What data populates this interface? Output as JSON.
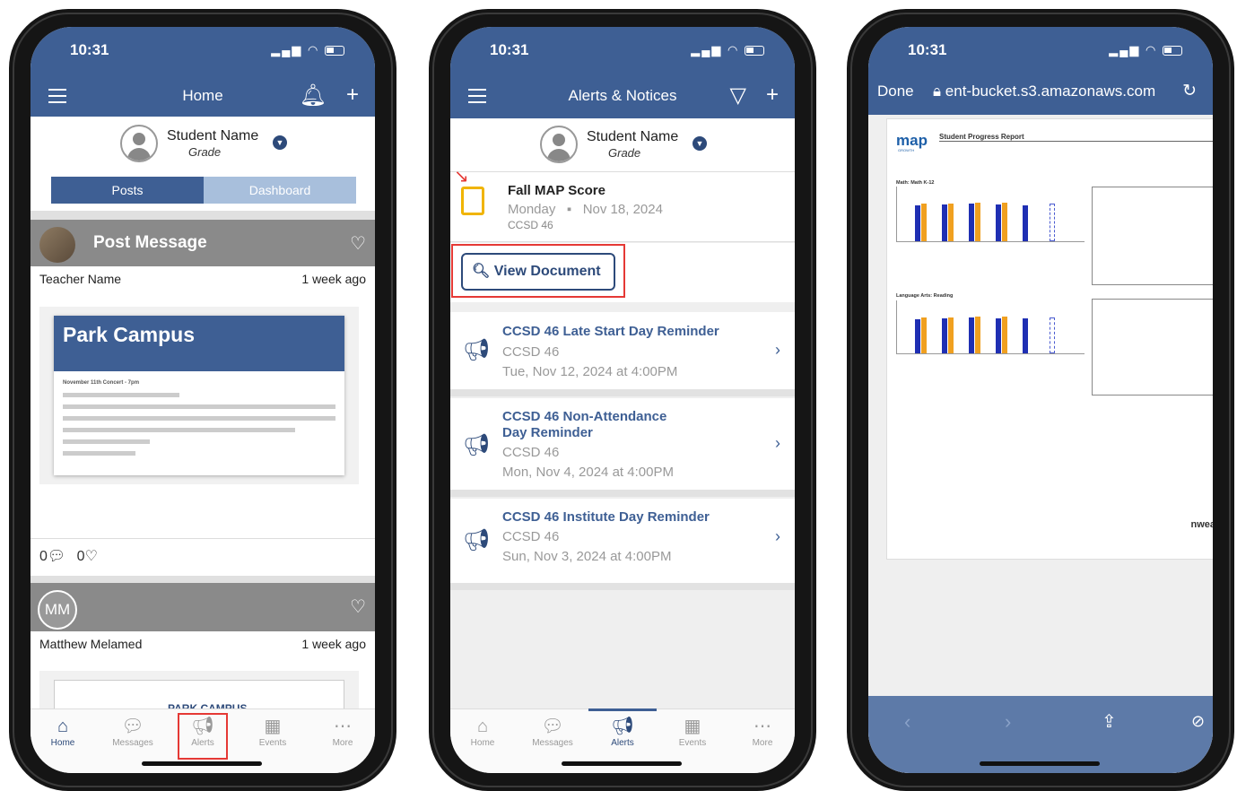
{
  "status_time": "10:31",
  "phone1": {
    "title": "Home",
    "student": {
      "name": "Student Name",
      "grade": "Grade"
    },
    "segments": [
      "Posts",
      "Dashboard"
    ],
    "post1": {
      "title": "Post Message",
      "author": "Teacher Name",
      "age": "1 week ago",
      "card_title": "Park Campus",
      "card_line": "November 11th Concert - 7pm",
      "comments": "0",
      "likes": "0"
    },
    "post2": {
      "initials": "MM",
      "author": "Matthew Melamed",
      "age": "1 week ago",
      "card_title": "PARK CAMPUS"
    },
    "tabs": [
      {
        "label": "Home",
        "icon": "home-icon"
      },
      {
        "label": "Messages",
        "icon": "messages-icon"
      },
      {
        "label": "Alerts",
        "icon": "megaphone-icon"
      },
      {
        "label": "Events",
        "icon": "calendar-icon"
      },
      {
        "label": "More",
        "icon": "more-icon"
      }
    ]
  },
  "phone2": {
    "title": "Alerts & Notices",
    "student": {
      "name": "Student Name",
      "grade": "Grade"
    },
    "doc_alert": {
      "title": "Fall MAP Score",
      "day": "Monday",
      "date": "Nov 18, 2024",
      "org": "CCSD 46",
      "button": "View Document"
    },
    "notices": [
      {
        "title": "CCSD 46 Late Start Day Reminder",
        "org": "CCSD 46",
        "when": "Tue, Nov 12, 2024 at 4:00PM"
      },
      {
        "title": "CCSD 46 Non-Attendance Day Reminder",
        "org": "CCSD 46",
        "when": "Mon, Nov 4, 2024 at 4:00PM"
      },
      {
        "title": "CCSD 46 Institute Day Reminder",
        "org": "CCSD 46",
        "when": "Sun, Nov 3, 2024 at 4:00PM"
      }
    ],
    "tabs": [
      {
        "label": "Home"
      },
      {
        "label": "Messages"
      },
      {
        "label": "Alerts"
      },
      {
        "label": "Events"
      },
      {
        "label": "More"
      }
    ]
  },
  "phone3": {
    "done": "Done",
    "url": "ent-bucket.s3.amazonaws.com",
    "doc": {
      "logo": "map",
      "logo_sub": "GROWTH",
      "title": "Student Progress Report",
      "section1": "Math: Math K-12",
      "section2": "Language Arts: Reading",
      "brand": "nwea"
    }
  }
}
